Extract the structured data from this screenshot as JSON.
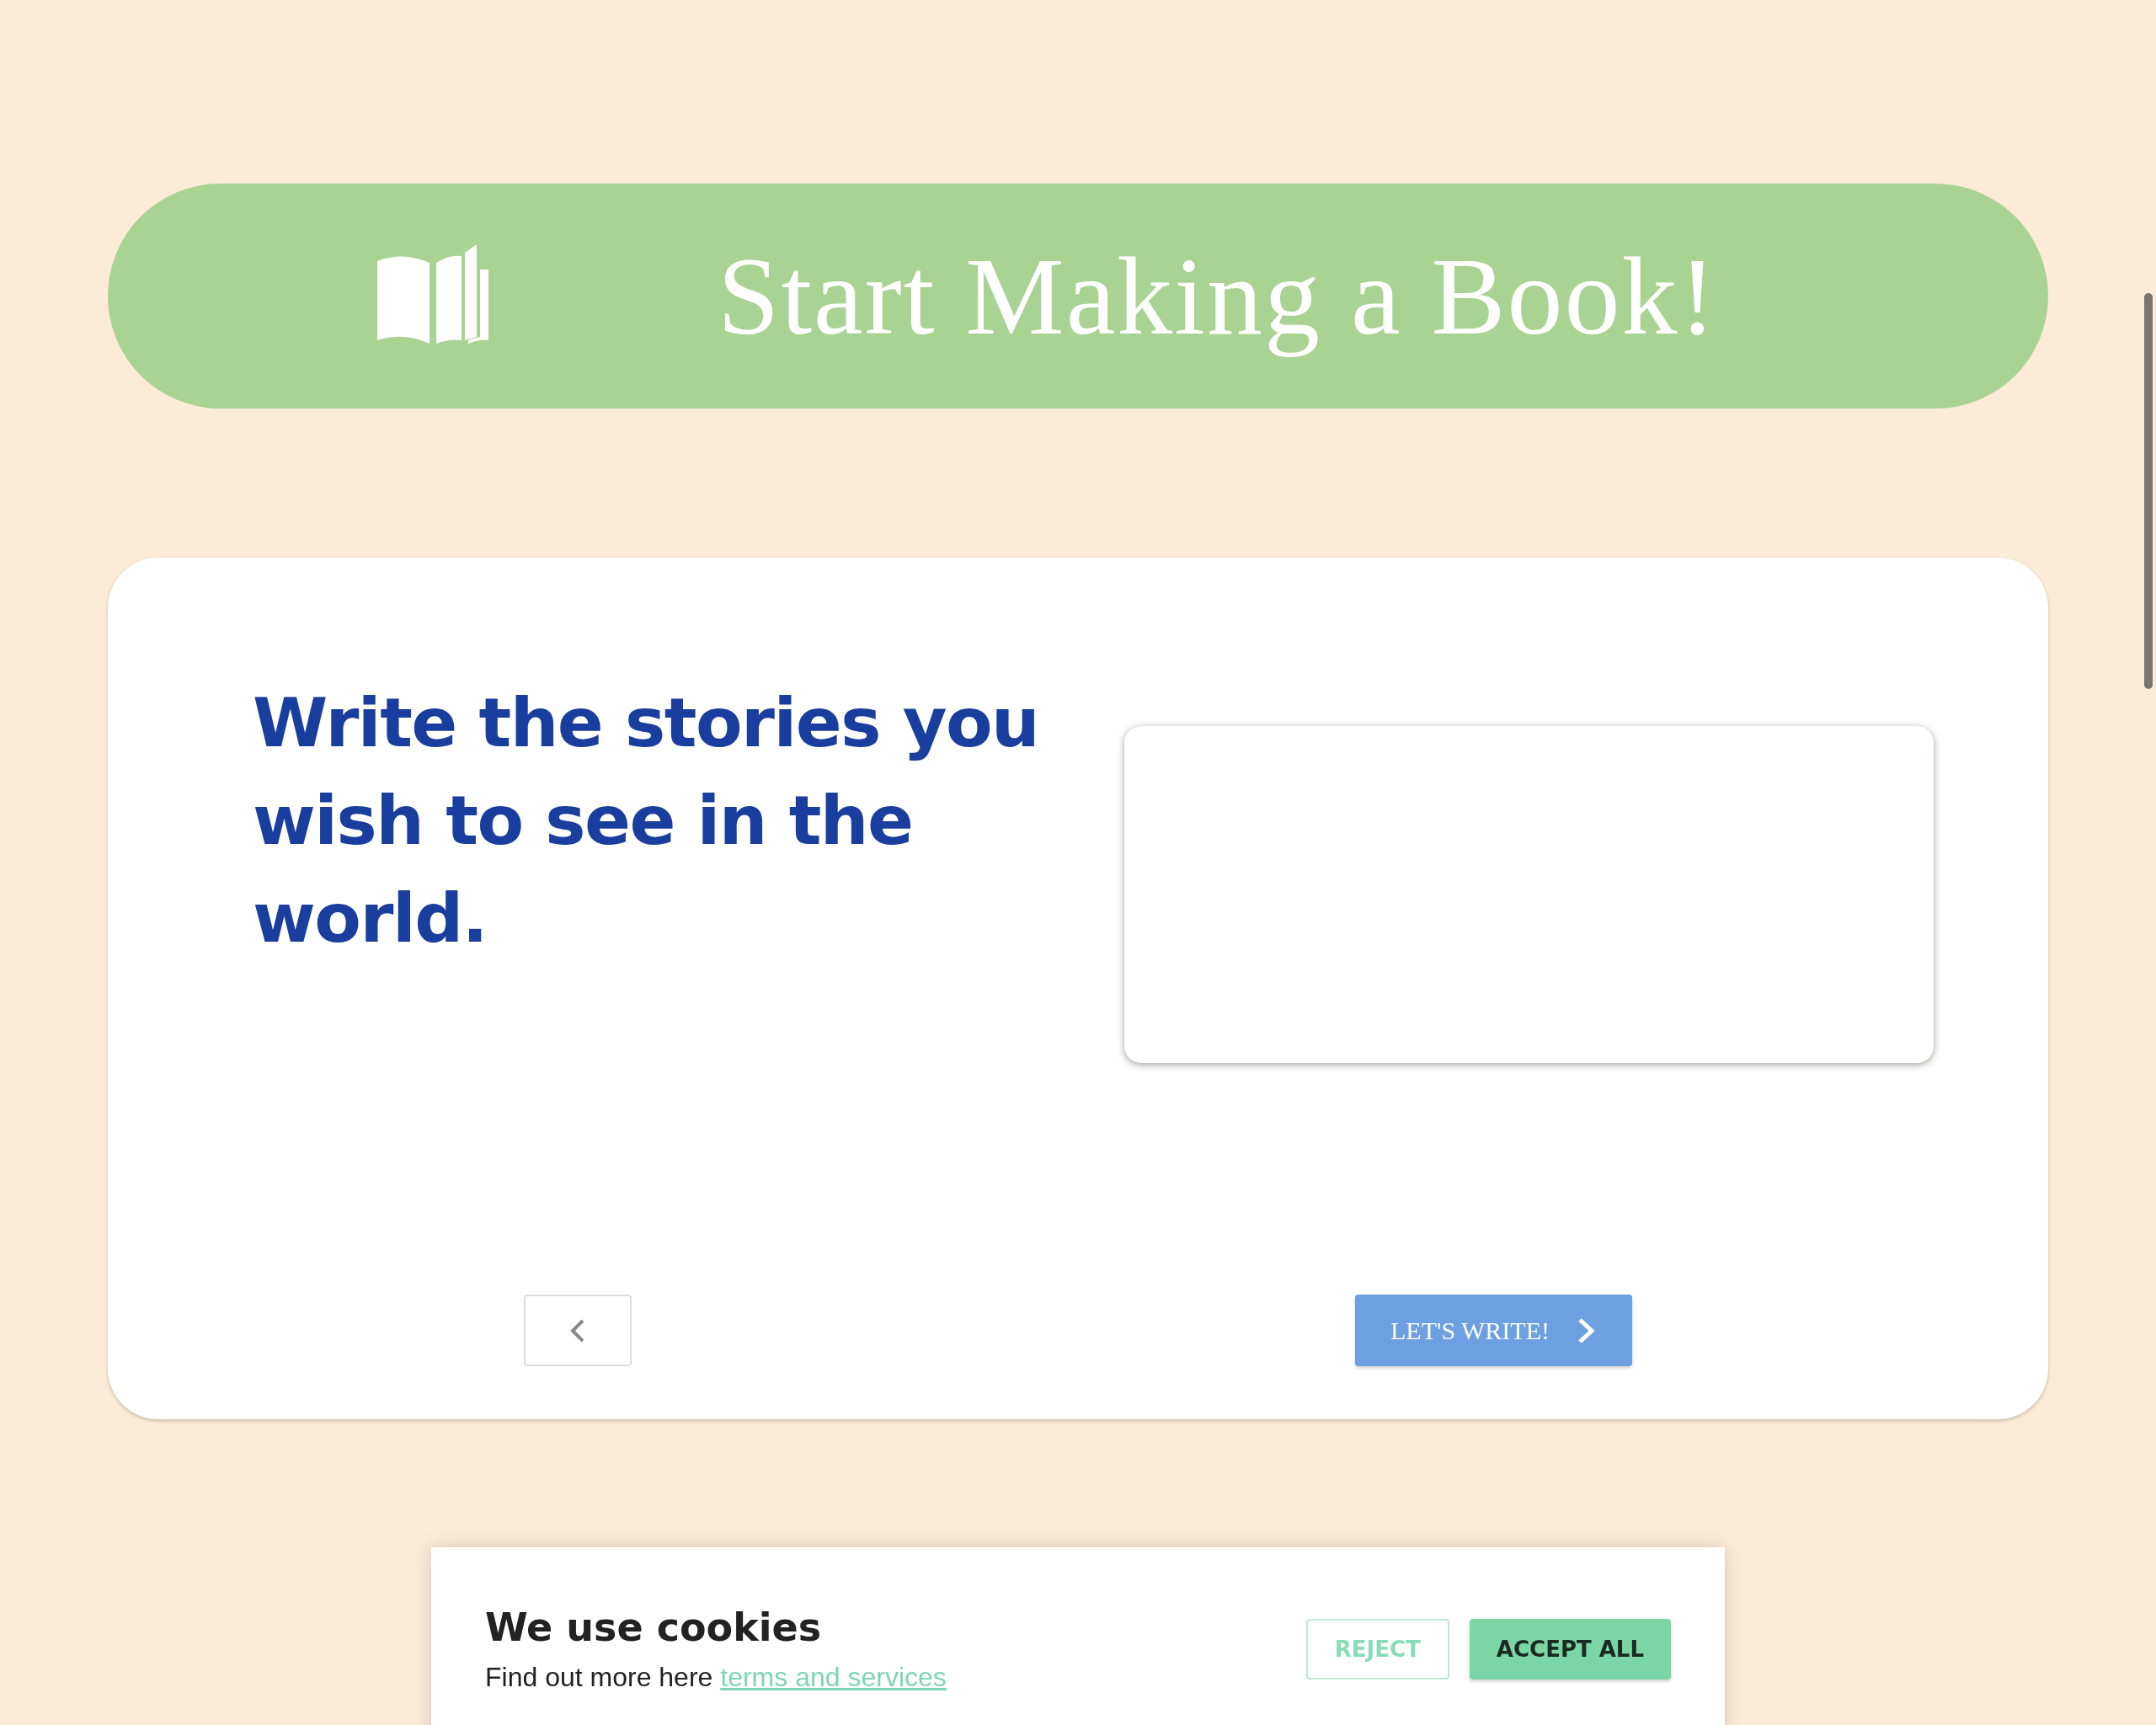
{
  "header": {
    "title": "Start Making a Book!"
  },
  "card": {
    "heading": "Write the stories you wish to see in the world.",
    "next_button": {
      "label": "LET'S WRITE!"
    }
  },
  "cookie_banner": {
    "title": "We use cookies",
    "text": "Find out more here",
    "link": "terms and services",
    "buttons": [
      {
        "label": "REJECT",
        "kind": "outline"
      },
      {
        "label": "ACCEPT ALL",
        "kind": "filled"
      }
    ]
  }
}
